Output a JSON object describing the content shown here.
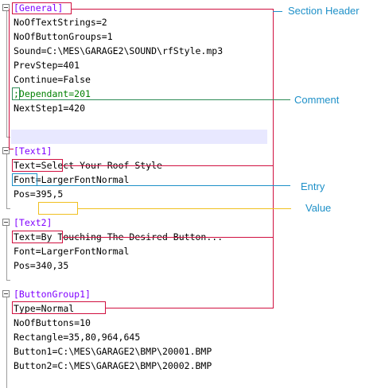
{
  "editor": {
    "lines": [
      {
        "kind": "section",
        "text": "[General]"
      },
      {
        "kind": "entry",
        "key": "NoOfTextStrings",
        "value": "2"
      },
      {
        "kind": "entry",
        "key": "NoOfButtonGroups",
        "value": "1"
      },
      {
        "kind": "entry",
        "key": "Sound",
        "value": "C:\\MES\\GARAGE2\\SOUND\\rfStyle.mp3"
      },
      {
        "kind": "entry",
        "key": "PrevStep",
        "value": "401"
      },
      {
        "kind": "entry",
        "key": "Continue",
        "value": "False"
      },
      {
        "kind": "comment",
        "text": ";Dependant=201"
      },
      {
        "kind": "entry",
        "key": "NextStep1",
        "value": "420"
      },
      {
        "kind": "blank",
        "text": ""
      },
      {
        "kind": "blank",
        "text": ""
      },
      {
        "kind": "section",
        "text": "[Text1]"
      },
      {
        "kind": "entry",
        "key": "Text",
        "value": "Select Your Roof Style"
      },
      {
        "kind": "entry",
        "key": "Font",
        "value": "LargerFontNormal"
      },
      {
        "kind": "entry",
        "key": "Pos",
        "value": "395,5"
      },
      {
        "kind": "blank",
        "text": ""
      },
      {
        "kind": "section",
        "text": "[Text2]"
      },
      {
        "kind": "entry",
        "key": "Text",
        "value": "By Touching The Desired Button..."
      },
      {
        "kind": "entry",
        "key": "Font",
        "value": "LargerFontNormal"
      },
      {
        "kind": "entry",
        "key": "Pos",
        "value": "340,35"
      },
      {
        "kind": "blank",
        "text": ""
      },
      {
        "kind": "section",
        "text": "[ButtonGroup1]"
      },
      {
        "kind": "entry",
        "key": "Type",
        "value": "Normal"
      },
      {
        "kind": "entry",
        "key": "NoOfButtons",
        "value": "10"
      },
      {
        "kind": "entry",
        "key": "Rectangle",
        "value": "35,80,964,645"
      },
      {
        "kind": "entry",
        "key": "Button1",
        "value": "C:\\MES\\GARAGE2\\BMP\\20001.BMP"
      },
      {
        "kind": "entry",
        "key": "Button2",
        "value": "C:\\MES\\GARAGE2\\BMP\\20002.BMP"
      }
    ]
  },
  "annotations": {
    "section_header": "Section Header",
    "comment": "Comment",
    "entry": "Entry",
    "value": "Value"
  },
  "colors": {
    "section": "#8000ff",
    "comment": "#008000",
    "section_callout": "#d01040",
    "comment_callout": "#2e8b57",
    "entry_callout": "#1e90c8",
    "value_callout": "#f0c020",
    "label": "#1e90c8"
  }
}
